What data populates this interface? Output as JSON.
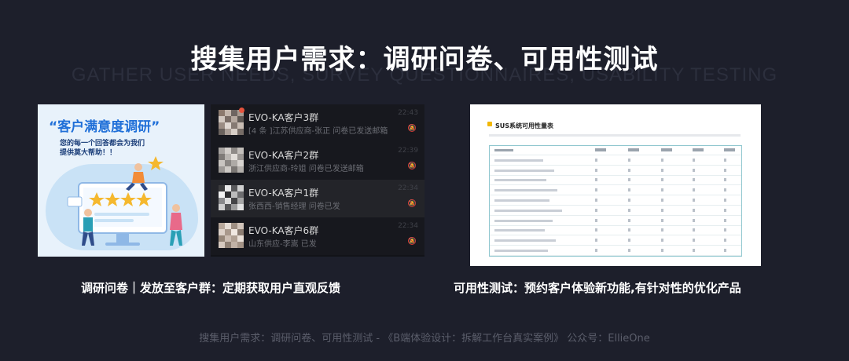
{
  "slide": {
    "title": "搜集用户需求：调研问卷、可用性测试",
    "title_bg": "GATHER USER NEEDS, SURVEY QUESTIONNAIRES, USABILITY TESTING",
    "footer": "搜集用户需求：调研问卷、可用性测试 - 《B端体验设计：拆解工作台真实案例》 公众号：EllieOne"
  },
  "poster": {
    "title": "“客户满意度调研”",
    "subtitle_line1": "您的每一个回答都会为我们",
    "subtitle_line2": "提供莫大帮助！！",
    "colors": {
      "title": "#1f6fd8",
      "background": "#e8f2fb"
    }
  },
  "chat": {
    "items": [
      {
        "name": "EVO-KA客户3群",
        "message": "[4 条 ]江苏供应商-张正 问卷已发送邮箱",
        "time": "22:43",
        "mute": "🔕",
        "unread": true
      },
      {
        "name": "EVO-KA客户2群",
        "message": "浙江供应商-玲姐 问卷已发送邮箱",
        "time": "22:39",
        "mute": "🔕",
        "unread": false
      },
      {
        "name": "EVO-KA客户1群",
        "message": "张西西-销售经理 问卷已发",
        "time": "22:34",
        "mute": "🔕",
        "unread": false
      },
      {
        "name": "EVO-KA客户6群",
        "message": "山东供应-李嵩 已发",
        "time": "22:34",
        "mute": "🔕",
        "unread": false
      }
    ]
  },
  "sus": {
    "title": "SUS系统可用性量表"
  },
  "captions": {
    "left": "调研问卷｜发放至客户群：定期获取用户直观反馈",
    "right": "可用性测试：预约客户体验新功能,有针对性的优化产品"
  }
}
